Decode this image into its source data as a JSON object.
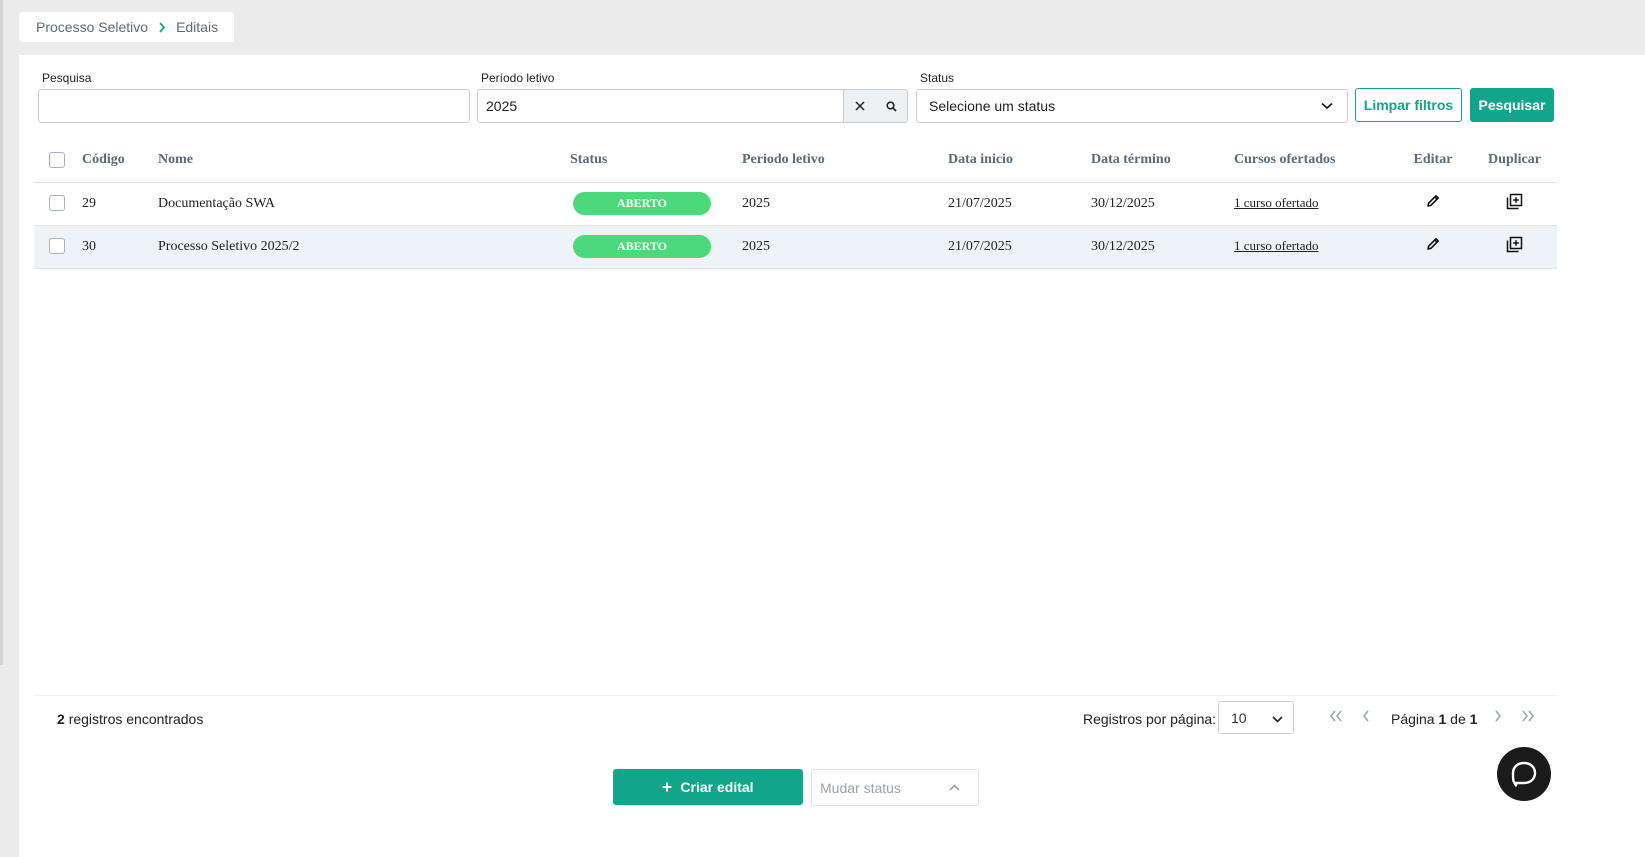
{
  "breadcrumb": {
    "parent": "Processo Seletivo",
    "current": "Editais"
  },
  "filters": {
    "search_label": "Pesquisa",
    "search_value": "",
    "period_label": "Período letivo",
    "period_value": "2025",
    "status_label": "Status",
    "status_placeholder": "Selecione um status",
    "clear_label": "Limpar filtros",
    "search_button": "Pesquisar"
  },
  "table": {
    "headers": {
      "code": "Código",
      "name": "Nome",
      "status": "Status",
      "period": "Periodo letivo",
      "start": "Data inicio",
      "end": "Data término",
      "courses": "Cursos ofertados",
      "edit": "Editar",
      "duplicate": "Duplicar"
    },
    "rows": [
      {
        "code": "29",
        "name": "Documentação SWA",
        "status": "ABERTO",
        "period": "2025",
        "start": "21/07/2025",
        "end": "30/12/2025",
        "courses": "1 curso ofertado"
      },
      {
        "code": "30",
        "name": "Processo Seletivo 2025/2",
        "status": "ABERTO",
        "period": "2025",
        "start": "21/07/2025",
        "end": "30/12/2025",
        "courses": "1 curso ofertado"
      }
    ]
  },
  "footer": {
    "count": "2",
    "count_suffix": "registros encontrados",
    "per_page_label": "Registros por página:",
    "per_page_value": "10",
    "page_prefix": "Página",
    "page_current": "1",
    "page_of": "de",
    "page_total": "1"
  },
  "actions": {
    "create_label": "Criar edital",
    "status_placeholder": "Mudar status"
  },
  "colors": {
    "accent": "#12a58c",
    "badge": "#4cd97b",
    "chat": "#1b1b1b"
  },
  "icons": [
    "chevron-right-icon",
    "clear-icon",
    "search-icon",
    "chevron-down-icon",
    "pencil-icon",
    "duplicate-icon",
    "first-page-icon",
    "prev-page-icon",
    "next-page-icon",
    "last-page-icon",
    "plus-icon",
    "chevron-up-icon",
    "chat-icon"
  ]
}
